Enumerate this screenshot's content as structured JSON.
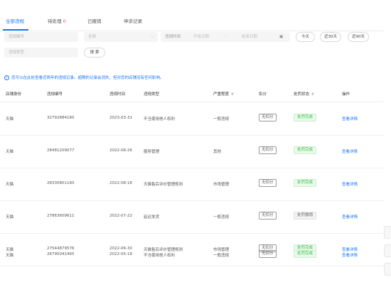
{
  "tabs": [
    {
      "label": "全部违规",
      "badge": ""
    },
    {
      "label": "待处理",
      "badge": "0"
    },
    {
      "label": "已撤销",
      "badge": ""
    },
    {
      "label": "申诉记录",
      "badge": ""
    }
  ],
  "filters": {
    "violation_no_placeholder": "违规编号",
    "type_select_value": "全部",
    "violation_time_label": "违规时间",
    "start_date_placeholder": "开始日期",
    "range_sep": "-",
    "end_date_placeholder": "结束日期",
    "quick_today": "今天",
    "quick_30": "近30天",
    "quick_90": "近90天",
    "type_placeholder": "违规类型",
    "search_label": "搜 索"
  },
  "notice": {
    "icon": "info-icon",
    "text": "您可以在此处查看近两年的违规记录。超期的记录会消失，但对您的店铺没有任何影响。"
  },
  "table": {
    "columns": [
      "店铺身份",
      "违规编号",
      "违规时间",
      "违规类型",
      "严重程度",
      "扣分",
      "处罚状态",
      "操作"
    ],
    "rows": [
      {
        "shop": "天猫",
        "id": "32792884160",
        "time": "2023-03-31",
        "type": "不当使用他人权利",
        "severity": "一般违规",
        "deduct": "无扣分",
        "status": "处罚完成",
        "status_color": "green",
        "action": "查看详情"
      },
      {
        "shop": "天猫",
        "id": "28481209077",
        "time": "2022-08-26",
        "type": "服务管理",
        "severity": "其他",
        "deduct": "无扣分",
        "status": "处罚完成",
        "status_color": "green",
        "action": "查看详情"
      },
      {
        "shop": "天猫",
        "id": "28330801160",
        "time": "2022-08-16",
        "type": "天猫售后评价管理规则",
        "severity": "市场管理",
        "deduct": "无扣分",
        "status": "处罚完成",
        "status_color": "green",
        "action": "查看详情"
      },
      {
        "shop": "天猫",
        "id": "27863609611",
        "time": "2022-07-22",
        "type": "延迟发货",
        "severity": "一般违规",
        "deduct": "无扣分",
        "status": "处罚撤销",
        "status_color": "grey",
        "action": "查看详情"
      },
      {
        "shop": "天猫",
        "id": "27544879576",
        "time": "2022-06-30",
        "type": "天猫售后评价管理规则",
        "severity": "市场管理",
        "deduct": "无扣分",
        "status": "处罚完成",
        "status_color": "green",
        "action": "查看详情"
      },
      {
        "shop": "天猫",
        "id": "26795041465",
        "time": "2022-05-18",
        "type": "不当使用他人权利",
        "severity": "一般违规",
        "deduct": "无扣分",
        "status": "处罚完成",
        "status_color": "green",
        "action": "查看详情"
      }
    ]
  },
  "colors": {
    "accent": "#1677ff",
    "success": "#2fbf3a",
    "badge": "#ff4d4f"
  }
}
